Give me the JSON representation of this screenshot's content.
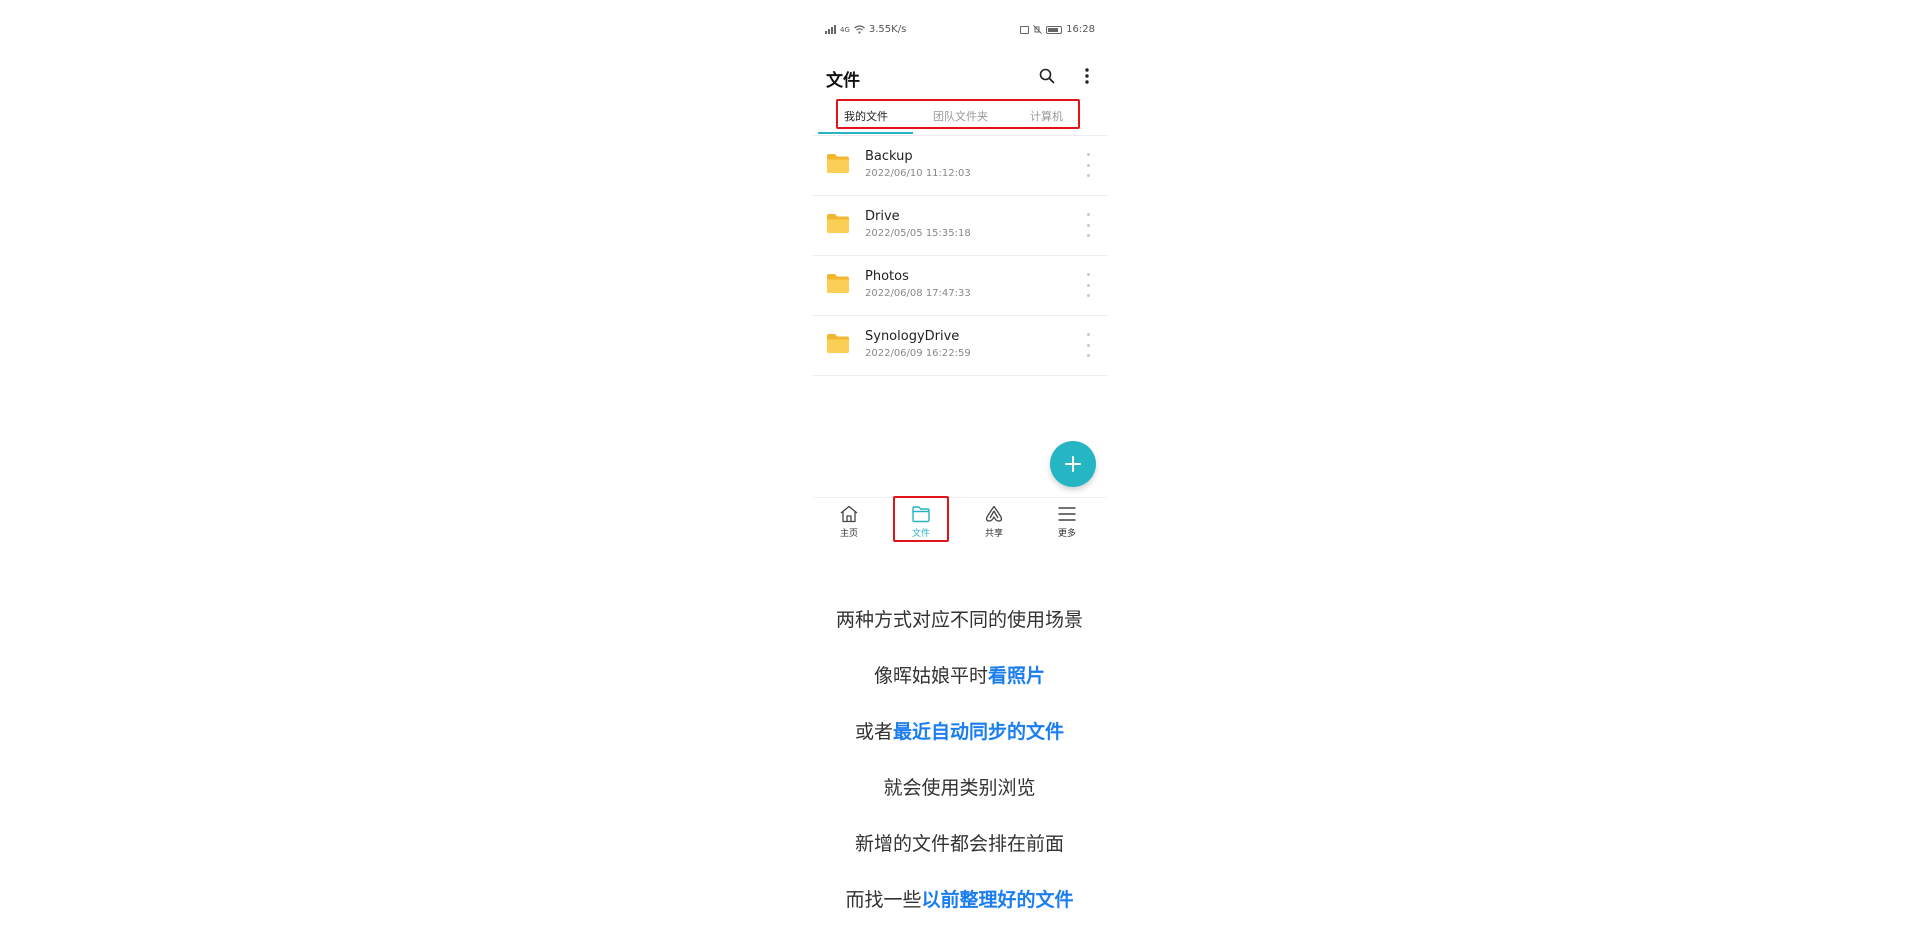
{
  "status_bar": {
    "network_type": "4G",
    "speed": "3.55K/s",
    "time": "16:28"
  },
  "header": {
    "title": "文件",
    "icons": [
      "search-icon",
      "more-vertical-icon"
    ]
  },
  "tabs": [
    {
      "label": "我的文件",
      "active": true
    },
    {
      "label": "团队文件夹",
      "active": false
    },
    {
      "label": "计算机",
      "active": false
    }
  ],
  "files": [
    {
      "name": "Backup",
      "date": "2022/06/10 11:12:03"
    },
    {
      "name": "Drive",
      "date": "2022/05/05 15:35:18"
    },
    {
      "name": "Photos",
      "date": "2022/06/08 17:47:33"
    },
    {
      "name": "SynologyDrive",
      "date": "2022/06/09 16:22:59"
    }
  ],
  "fab": {
    "icon": "plus-icon"
  },
  "bottom_nav": [
    {
      "label": "主页",
      "icon": "home-icon",
      "active": false
    },
    {
      "label": "文件",
      "icon": "folder-icon",
      "active": true
    },
    {
      "label": "共享",
      "icon": "share-icon",
      "active": false
    },
    {
      "label": "更多",
      "icon": "menu-icon",
      "active": false
    }
  ],
  "captions": [
    {
      "text": "两种方式对应不同的使用场景",
      "highlight": ""
    },
    {
      "text": "像晖姑娘平时",
      "highlight": "看照片"
    },
    {
      "text": "或者",
      "highlight": "最近自动同步的文件"
    },
    {
      "text": "就会使用类别浏览",
      "highlight": ""
    },
    {
      "text": "新增的文件都会排在前面",
      "highlight": ""
    },
    {
      "text": "而找一些",
      "highlight": "以前整理好的文件"
    }
  ],
  "colors": {
    "accent": "#26b5c2",
    "annotation_red": "#e0141a",
    "caption_highlight": "#1a7ef0",
    "folder": "#f7c742"
  }
}
